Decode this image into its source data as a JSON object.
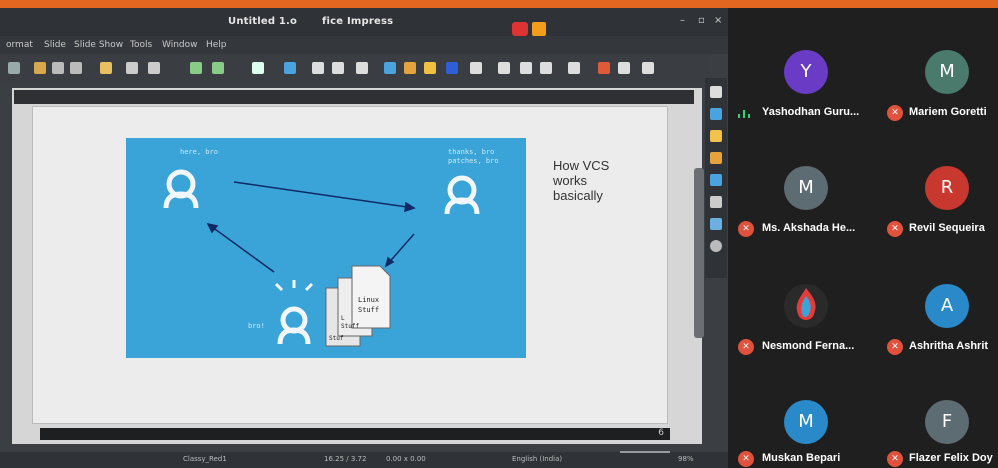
{
  "window": {
    "title": "Untitled 1.o",
    "title_suffix": "fice Impress",
    "controls": [
      "–",
      "▫",
      "×"
    ]
  },
  "menubar": {
    "items": [
      "ormat",
      "Slide",
      "Slide Show",
      "Tools",
      "Window",
      "Help"
    ]
  },
  "slide": {
    "text": [
      "How VCS",
      "works",
      "basically"
    ],
    "diagram_labels": {
      "top_left": "here, bro",
      "top_right_1": "thanks, bro",
      "top_right_2": "patches, bro",
      "bottom": "bro!",
      "paper_front_1": "Linux",
      "paper_front_2": "Stuff",
      "paper_back_1": "L",
      "paper_back_2": "Stuff",
      "paper_back_3": "Stuf"
    },
    "page_number": "6"
  },
  "statusbar": {
    "layout": "Classy_Red1",
    "position": "16.25 / 3.72",
    "size": "0.00 x 0.00",
    "language": "English (India)",
    "zoom": "98%"
  },
  "participants": [
    {
      "name": "Yashodhan Guru...",
      "initial": "Y",
      "color": "#6a3cc6",
      "muted": false
    },
    {
      "name": "Mariem Goretti",
      "initial": "M",
      "color": "#4a7a6c",
      "muted": true
    },
    {
      "name": "Ms. Akshada He...",
      "initial": "M",
      "color": "#5d6c72",
      "muted": true
    },
    {
      "name": "Revil Sequeira",
      "initial": "R",
      "color": "#c8382e",
      "muted": true
    },
    {
      "name": "Nesmond Ferna...",
      "initial": "",
      "color": "#2a2a2a",
      "muted": true
    },
    {
      "name": "Ashritha Ashrit",
      "initial": "A",
      "color": "#2a89c9",
      "muted": true
    },
    {
      "name": "Muskan Bepari",
      "initial": "M",
      "color": "#2a89c9",
      "muted": true
    },
    {
      "name": "Flazer Felix Doy",
      "initial": "F",
      "color": "#5d6c72",
      "muted": true
    }
  ],
  "colors": {
    "accent_orange": "#e2661f",
    "slide_blue": "#3aa4d8",
    "muted_red": "#e0523c",
    "speaking_green": "#33d17a"
  }
}
